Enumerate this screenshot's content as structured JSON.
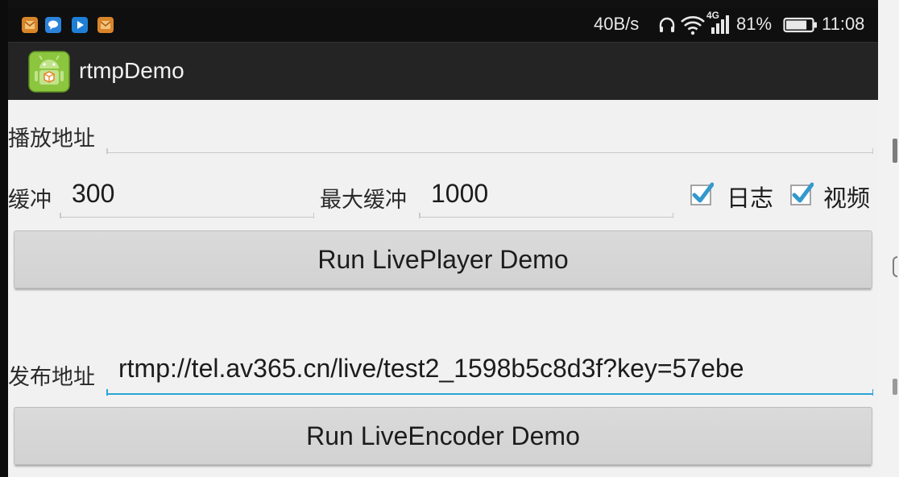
{
  "status_bar": {
    "net_speed": "40B/s",
    "network_type": "4G",
    "battery_percent": "81%",
    "battery_level": 0.81,
    "time": "11:08",
    "notification_icons": [
      "app-notification-icon-orange",
      "message-notification-icon",
      "play-notification-icon",
      "app-notification-icon-orange-2"
    ],
    "icons": [
      "headset-icon",
      "wifi-icon",
      "signal-icon",
      "battery-icon"
    ]
  },
  "action_bar": {
    "title": "rtmpDemo",
    "icon": "android-app-icon"
  },
  "player": {
    "url_label": "播放地址",
    "url_value": "",
    "buffer_label": "缓冲",
    "buffer_value": "300",
    "max_buffer_label": "最大缓冲",
    "max_buffer_value": "1000",
    "log_label": "日志",
    "log_checked": true,
    "video_label": "视频",
    "video_checked": true,
    "run_button": "Run LivePlayer Demo"
  },
  "encoder": {
    "url_label": "发布地址",
    "url_value": "rtmp://tel.av365.cn/live/test2_1598b5c8d3f?key=57ebe",
    "run_button": "Run LiveEncoder Demo"
  },
  "colors": {
    "accent": "#2aa5d6",
    "checkbox": "#3399cc",
    "status_bar": "#0f0f0f",
    "action_bar": "#242424",
    "background": "#f1f1f1"
  }
}
